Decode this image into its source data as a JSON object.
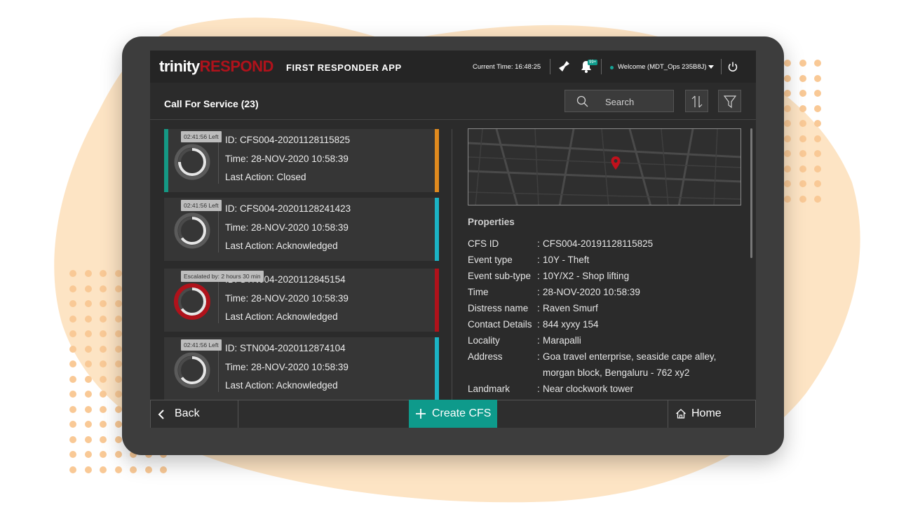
{
  "colors": {
    "accent": "#0e9a8b",
    "brand_red": "#b0121b",
    "bar_orange": "#e08a1e",
    "bar_teal": "#1bb3c4",
    "bar_red": "#b0121b",
    "bar_green": "#159884",
    "blob": "#fde4c4",
    "dots": "#f9c996"
  },
  "header": {
    "brand_part1": "trinity",
    "brand_part2": "RESPOND",
    "app_title": "FIRST RESPONDER APP",
    "current_time": "Current Time: 16:48:25",
    "notification_badge": "99+",
    "welcome": "Welcome (MDT_Ops 235B8J)",
    "icons": [
      "broom-icon",
      "bell-icon",
      "chevron-down-icon",
      "power-icon"
    ]
  },
  "subheader": {
    "title": "Call For Service (23)",
    "search_placeholder": "Search",
    "icons": [
      "search-icon",
      "sort-icon",
      "filter-icon"
    ]
  },
  "calls": [
    {
      "tip": "02:41:56 Left",
      "id": "ID: CFS004-20201128115825",
      "time": "Time: 28-NOV-2020 10:58:39",
      "last_action": "Last Action: Closed",
      "left_color": "#159884",
      "right_color": "#e08a1e",
      "progress": 0.75,
      "escalated": false
    },
    {
      "tip": "02:41:56 Left",
      "id": "ID: CFS004-20201128241423",
      "time": "Time: 28-NOV-2020 10:58:39",
      "last_action": "Last Action: Acknowledged",
      "left_color": "",
      "right_color": "#1bb3c4",
      "progress": 0.65,
      "escalated": false
    },
    {
      "tip": "Escalated by: 2 hours 30 min",
      "id": "ID: STN004-2020112845154",
      "time": "Time: 28-NOV-2020 10:58:39",
      "last_action": "Last Action: Acknowledged",
      "left_color": "",
      "right_color": "#b0121b",
      "progress": 0.65,
      "escalated": true
    },
    {
      "tip": "02:41:56 Left",
      "id": "ID: STN004-2020112874104",
      "time": "Time: 28-NOV-2020 10:58:39",
      "last_action": "Last Action: Acknowledged",
      "left_color": "",
      "right_color": "#1bb3c4",
      "progress": 0.65,
      "escalated": false
    }
  ],
  "properties": {
    "heading": "Properties",
    "rows": [
      {
        "key": "CFS ID",
        "value": "CFS004-20191128115825"
      },
      {
        "key": "Event type",
        "value": "10Y - Theft"
      },
      {
        "key": "Event sub-type",
        "value": "10Y/X2 - Shop lifting"
      },
      {
        "key": "Time",
        "value": "28-NOV-2020 10:58:39"
      },
      {
        "key": "Distress name",
        "value": "Raven Smurf"
      },
      {
        "key": "Contact Details",
        "value": "844 xyxy 154"
      },
      {
        "key": "Locality",
        "value": "Marapalli"
      },
      {
        "key": "Address",
        "value": "Goa travel enterprise, seaside cape alley,"
      },
      {
        "key": "",
        "value": "morgan block, Bengaluru - 762 xy2"
      },
      {
        "key": "Landmark",
        "value": "Near clockwork tower"
      }
    ]
  },
  "footer": {
    "back_label": "Back",
    "create_label": "Create CFS",
    "home_label": "Home"
  }
}
